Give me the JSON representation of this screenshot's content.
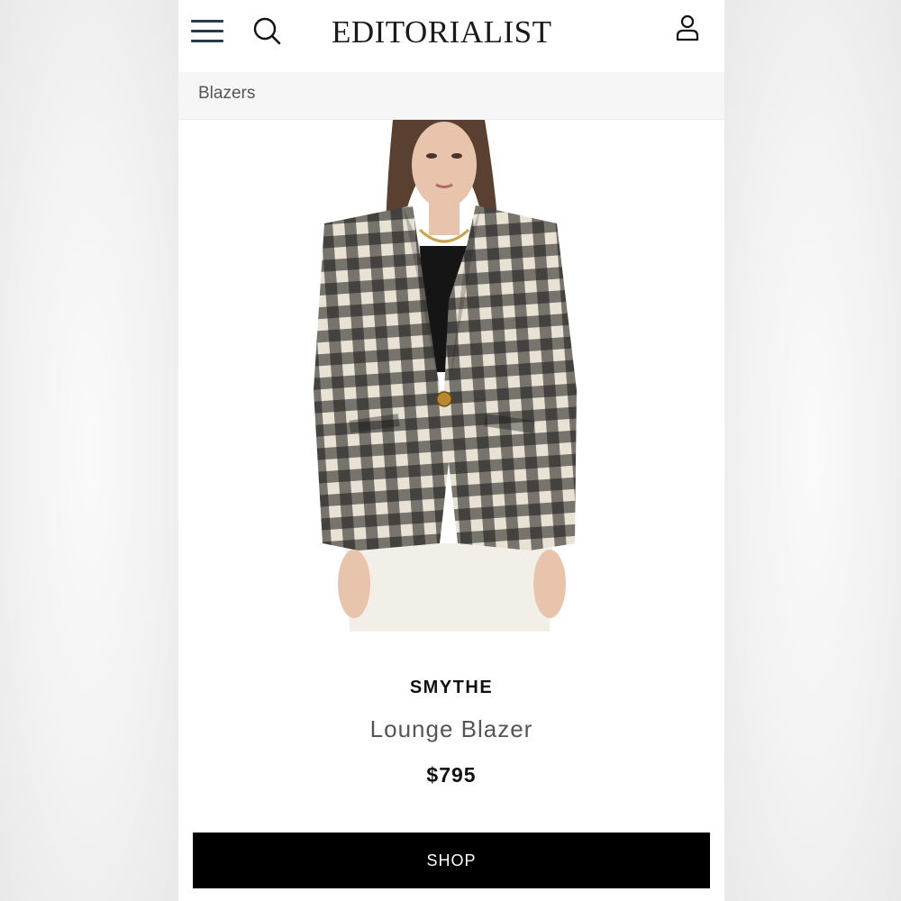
{
  "header": {
    "logo_text": "EDITORIALIST",
    "menu_icon": "hamburger-menu-icon",
    "search_icon": "search-icon",
    "account_icon": "user-icon"
  },
  "breadcrumb": {
    "label": "Blazers"
  },
  "product": {
    "brand": "SMYTHE",
    "name": "Lounge Blazer",
    "price": "$795",
    "image": "model wearing black and cream gingham blazer with white trousers"
  },
  "cta": {
    "label": "SHOP"
  },
  "colors": {
    "button_bg": "#000000",
    "button_text": "#ffffff",
    "breadcrumb_bg": "#f6f6f6",
    "icon_navy": "#2a3a4a"
  }
}
